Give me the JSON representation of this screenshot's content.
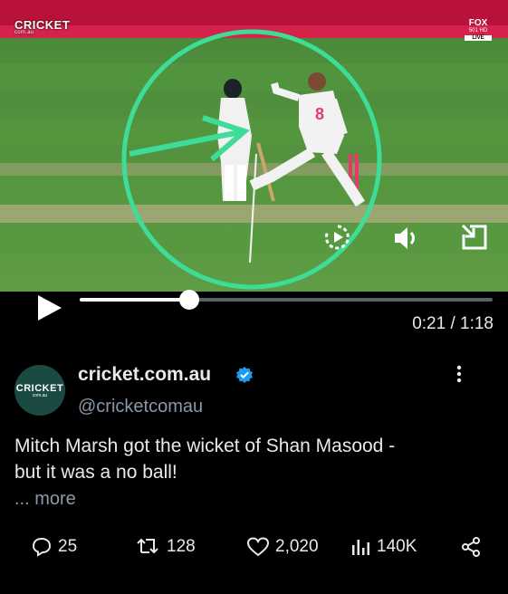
{
  "video": {
    "overlay_brand": "CRICKET",
    "overlay_brand_sub": "com.au",
    "fox_badge": "FOX",
    "fox_badge_sub": "501 HD",
    "fox_badge_live": "LIVE",
    "icons": [
      "replay-icon",
      "volume-icon",
      "minimize-icon",
      "play-icon"
    ],
    "progress": 0.2655,
    "time_display": "0:21 / 1:18",
    "highlight_color": "#3ddc97"
  },
  "post": {
    "display_name": "cricket.com.au",
    "handle": "@cricketcomau",
    "avatar_text": "CRICKET",
    "avatar_subtext": "com.au",
    "text_line1": "Mitch Marsh got the wicket of Shan Masood -",
    "text_line2": "but it was a no ball!",
    "more_label": "... more",
    "verified_color": "#1d9bf0"
  },
  "actions": {
    "replies": "25",
    "reposts": "128",
    "likes": "2,020",
    "views": "140K"
  }
}
